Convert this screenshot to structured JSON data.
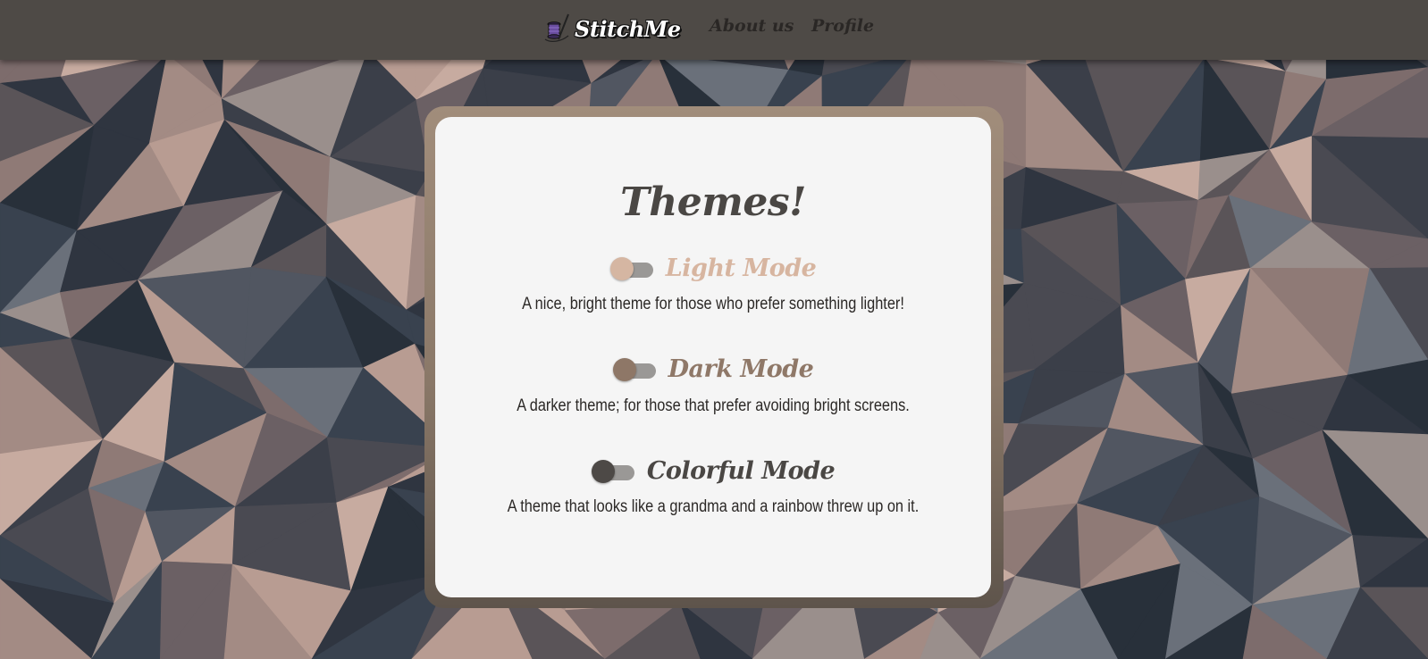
{
  "nav": {
    "brand": "StitchMe",
    "links": [
      "About us",
      "Profile"
    ]
  },
  "page": {
    "title": "Themes!"
  },
  "themes": [
    {
      "label": "Light Mode",
      "description": "A nice, bright theme for those who prefer something lighter!",
      "color": "#d7b5a0",
      "enabled": false
    },
    {
      "label": "Dark Mode",
      "description": "A darker theme; for those that prefer avoiding bright screens.",
      "color": "#8f7868",
      "enabled": false
    },
    {
      "label": "Colorful Mode",
      "description": "A theme that looks like a grandma and a rainbow threw up on it.",
      "color": "#4a4744",
      "enabled": false
    }
  ],
  "colors": {
    "navbar": "#4e4a46",
    "card": "#f5f5f5",
    "card_frame": "#8a7868",
    "text_dark": "#2b2826"
  },
  "icons": {
    "logo": "spool-needle-icon"
  }
}
